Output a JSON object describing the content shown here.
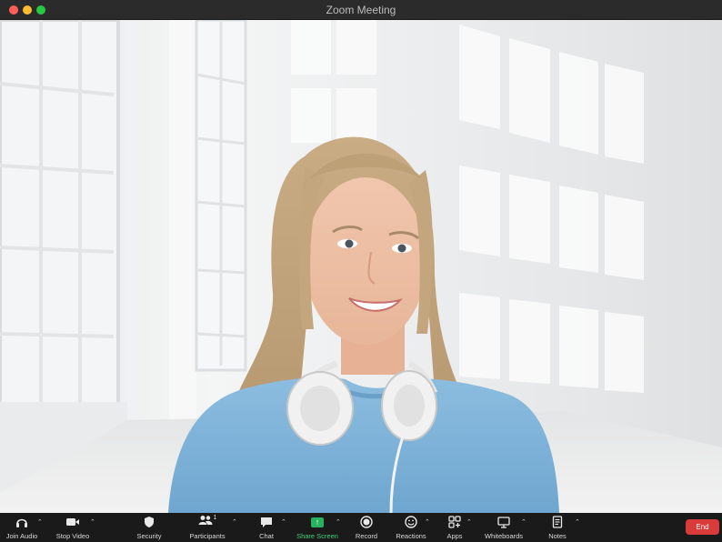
{
  "window": {
    "title": "Zoom Meeting"
  },
  "toolbar": {
    "join_audio": "Join Audio",
    "stop_video": "Stop Video",
    "security": "Security",
    "participants": "Participants",
    "participants_count": "1",
    "chat": "Chat",
    "share_screen": "Share Screen",
    "record": "Record",
    "reactions": "Reactions",
    "apps": "Apps",
    "whiteboards": "Whiteboards",
    "notes": "Notes",
    "end": "End"
  },
  "colors": {
    "share_accent": "#27b35d",
    "end_button": "#d93a3a",
    "toolbar_bg": "#1a1a1a",
    "sweater": "#7fb3d8"
  },
  "icons": [
    "headphones-icon",
    "video-camera-icon",
    "shield-icon",
    "people-icon",
    "chat-bubble-icon",
    "share-arrow-icon",
    "record-icon",
    "reaction-emoji-icon",
    "apps-icon",
    "whiteboard-icon",
    "notes-icon"
  ]
}
